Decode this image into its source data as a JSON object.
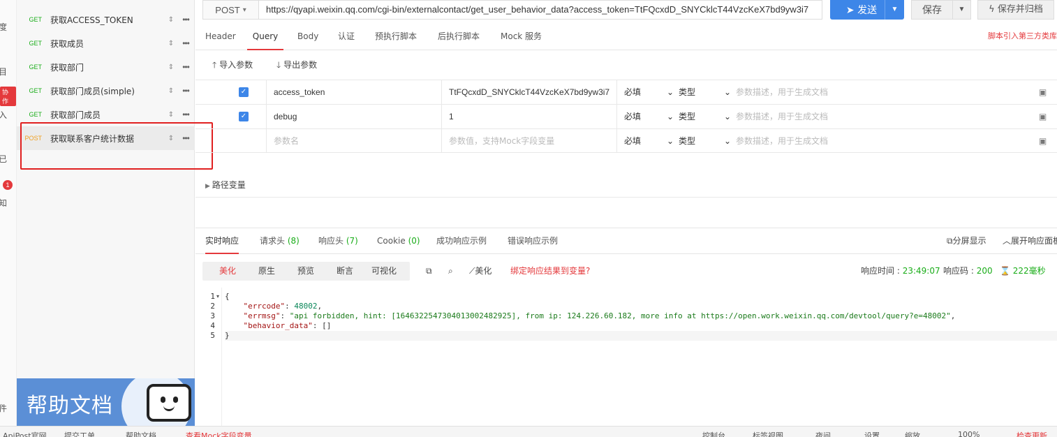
{
  "rail": {
    "labels": [
      "度",
      "目",
      "入",
      "已",
      "知",
      "件"
    ],
    "collab_badge": "协作",
    "notif_count": "1"
  },
  "tree": {
    "items": [
      {
        "method": "GET",
        "name": "获取ACCESS_TOKEN"
      },
      {
        "method": "GET",
        "name": "获取成员"
      },
      {
        "method": "GET",
        "name": "获取部门"
      },
      {
        "method": "GET",
        "name": "获取部门成员(simple)"
      },
      {
        "method": "GET",
        "name": "获取部门成员"
      },
      {
        "method": "POST",
        "name": "获取联系客户统计数据"
      }
    ],
    "help_banner": "帮助文档"
  },
  "topbar": {
    "method": "POST",
    "url": "https://qyapi.weixin.qq.com/cgi-bin/externalcontact/get_user_behavior_data?access_token=TtFQcxdD_SNYCklcT44VzcKeX7bd9yw3i7",
    "send_label": "发送",
    "save_label": "保存",
    "save_archive_label": "保存并归档"
  },
  "request_tabs": {
    "tabs": [
      "Header",
      "Query",
      "Body",
      "认证",
      "预执行脚本",
      "后执行脚本",
      "Mock 服务"
    ],
    "script_note": "脚本引入第三方类库"
  },
  "param_actions": {
    "import": "导入参数",
    "export": "导出参数"
  },
  "params": {
    "rows": [
      {
        "name": "access_token",
        "value": "TtFQcxdD_SNYCklcT44VzcKeX7bd9yw3i7",
        "required": "必填",
        "type": "类型",
        "desc_placeholder": "参数描述，用于生成文档"
      },
      {
        "name": "debug",
        "value": "1",
        "required": "必填",
        "type": "类型",
        "desc_placeholder": "参数描述，用于生成文档"
      }
    ],
    "new_row": {
      "name_placeholder": "参数名",
      "value_placeholder": "参数值，支持Mock字段变量",
      "required": "必填",
      "type": "类型",
      "desc_placeholder": "参数描述，用于生成文档"
    }
  },
  "path_vars_label": "路径变量",
  "response_tabs": {
    "realtime": "实时响应",
    "req_headers": "请求头",
    "req_headers_count": "(8)",
    "resp_headers": "响应头",
    "resp_headers_count": "(7)",
    "cookie": "Cookie",
    "cookie_count": "(0)",
    "success_example": "成功响应示例",
    "error_example": "错误响应示例",
    "split_view": "分屏显示",
    "expand_panel": "展开响应面板"
  },
  "response_toolbar": {
    "views": [
      "美化",
      "原生",
      "预览",
      "断言",
      "可视化"
    ],
    "beautify": "美化",
    "bind_var": "绑定响应结果到变量?",
    "time_label": "响应时间 :",
    "time_value": "23:49:07",
    "code_label": "响应码 :",
    "code_value": "200",
    "duration": "222毫秒"
  },
  "response_body": {
    "line_numbers": [
      "1",
      "2",
      "3",
      "4",
      "5"
    ],
    "open_brace": "{",
    "errcode_key": "\"errcode\"",
    "errcode_value": "48002",
    "errmsg_key": "\"errmsg\"",
    "errmsg_value": "\"api forbidden, hint: [1646322547304013002482925], from ip: 124.226.60.182, more info at https://open.work.weixin.qq.com/devtool/query?e=48002\"",
    "behavior_key": "\"behavior_data\"",
    "behavior_value": "[]",
    "close_brace": "}"
  },
  "statusbar": {
    "items": [
      "ApiPost官网",
      "提交工单",
      "帮助文档",
      "查看Mock字段变量",
      "控制台",
      "标签视图",
      "夜间",
      "设置",
      "缩放",
      "100%",
      "检查更新"
    ]
  },
  "colors": {
    "accent": "#e4393c",
    "primary": "#3d86e8",
    "success": "#1aad19",
    "post": "#f0a020"
  }
}
